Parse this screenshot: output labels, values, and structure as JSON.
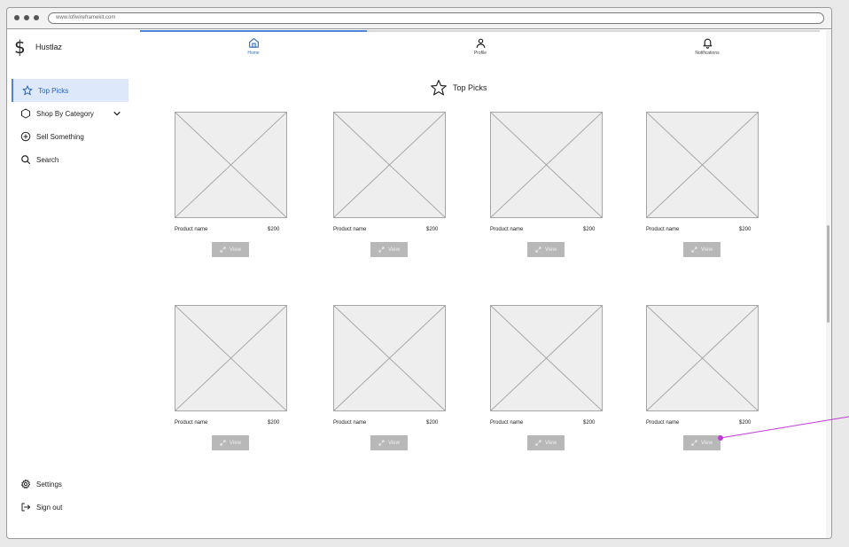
{
  "browser": {
    "url": "www.lofiwireframekit.com"
  },
  "brand": {
    "name": "Hustlaz",
    "icon": "dollar-sign-icon"
  },
  "sidebar": {
    "items": [
      {
        "label": "Top Picks",
        "icon": "star-icon",
        "active": true
      },
      {
        "label": "Shop By Category",
        "icon": "hexagon-icon",
        "has_dropdown": true
      },
      {
        "label": "Sell Something",
        "icon": "plus-circle-icon"
      },
      {
        "label": "Search",
        "icon": "search-icon"
      }
    ],
    "footer": [
      {
        "label": "Settings",
        "icon": "gear-icon"
      },
      {
        "label": "Sign out",
        "icon": "sign-out-icon"
      }
    ]
  },
  "topnav": {
    "tabs": [
      {
        "label": "Home",
        "icon": "home-icon",
        "active": true
      },
      {
        "label": "Profile",
        "icon": "user-icon"
      },
      {
        "label": "Notifications",
        "icon": "bell-icon"
      }
    ]
  },
  "main": {
    "title": "Top Picks",
    "products": [
      {
        "name": "Product name",
        "price": "$200",
        "button": "View"
      },
      {
        "name": "Product name",
        "price": "$200",
        "button": "View"
      },
      {
        "name": "Product name",
        "price": "$200",
        "button": "View"
      },
      {
        "name": "Product name",
        "price": "$200",
        "button": "View"
      },
      {
        "name": "Product name",
        "price": "$200",
        "button": "View"
      },
      {
        "name": "Product name",
        "price": "$200",
        "button": "View"
      },
      {
        "name": "Product name",
        "price": "$200",
        "button": "View"
      },
      {
        "name": "Product name",
        "price": "$200",
        "button": "View"
      }
    ]
  },
  "colors": {
    "accent": "#4c84d8",
    "active_bg": "#dde8fb",
    "annotation": "#c03ad6"
  }
}
